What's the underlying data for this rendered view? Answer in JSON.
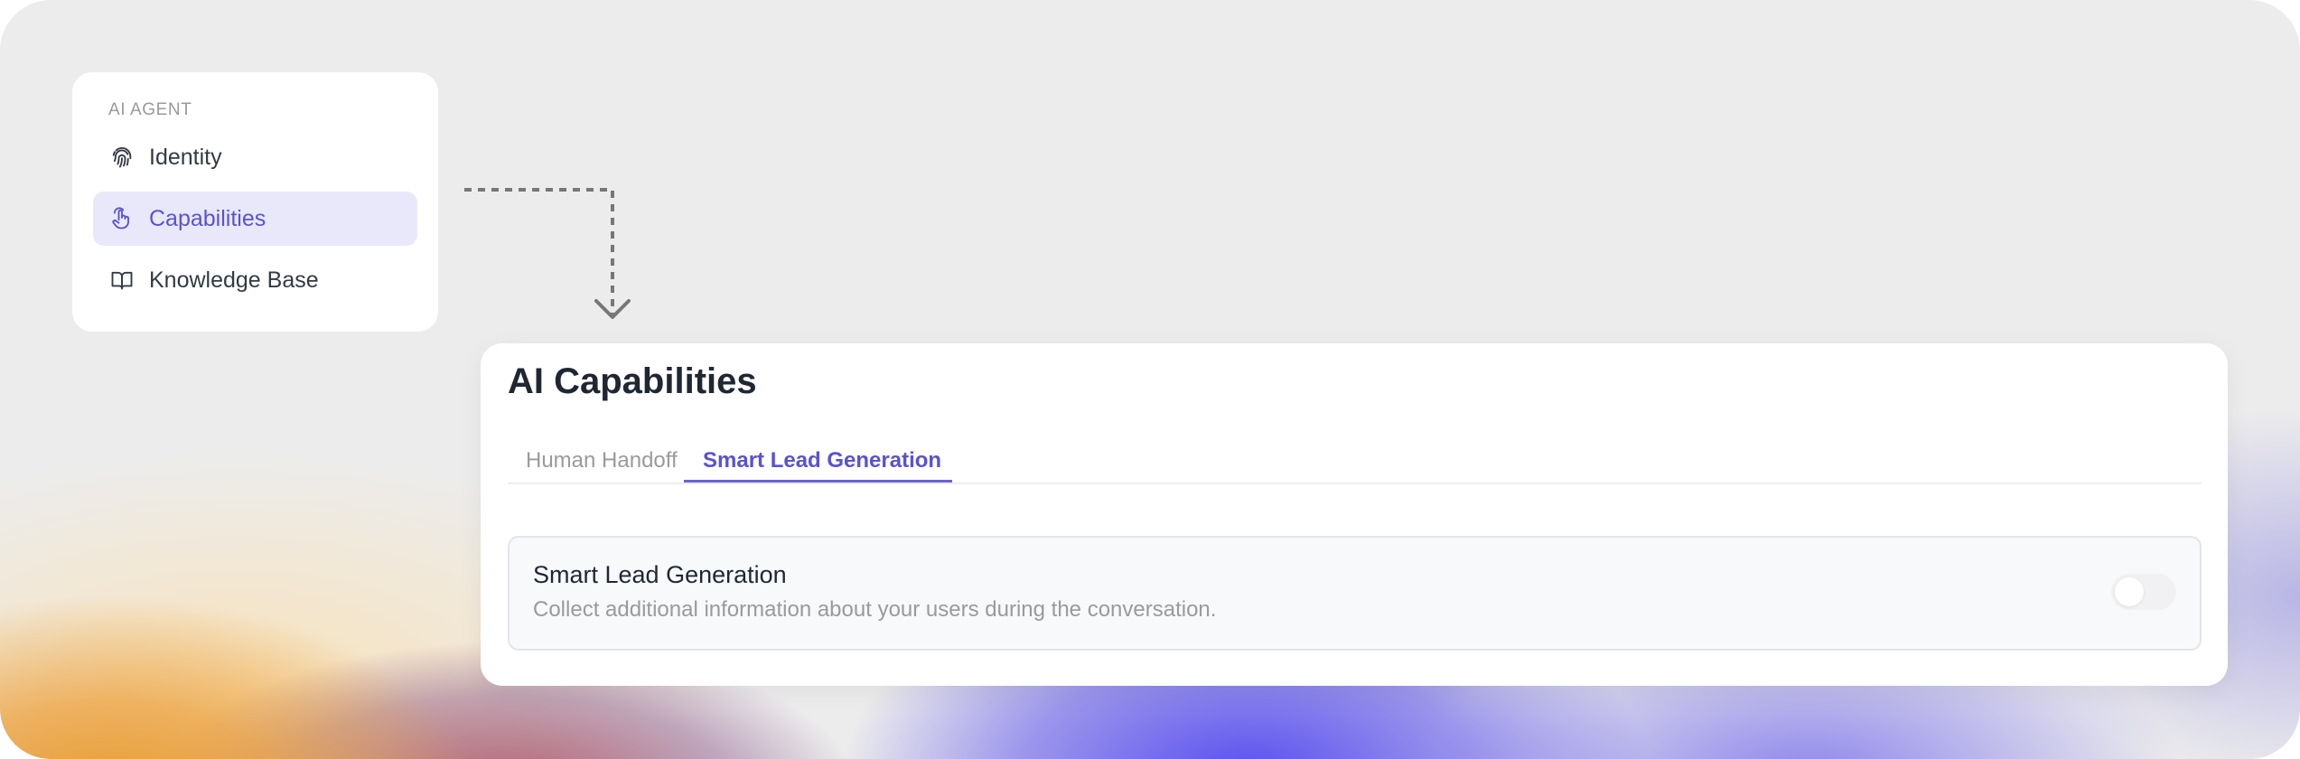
{
  "sidebar": {
    "section_label": "AI AGENT",
    "items": [
      {
        "label": "Identity",
        "icon": "fingerprint-icon",
        "active": false
      },
      {
        "label": "Capabilities",
        "icon": "pointer-hand-icon",
        "active": true
      },
      {
        "label": "Knowledge Base",
        "icon": "book-open-icon",
        "active": false
      }
    ]
  },
  "main": {
    "title": "AI Capabilities",
    "tabs": [
      {
        "label": "Human Handoff",
        "active": false
      },
      {
        "label": "Smart Lead Generation",
        "active": true
      }
    ],
    "setting": {
      "title": "Smart Lead Generation",
      "description": "Collect additional information about your users during the conversation.",
      "toggle_on": false
    }
  },
  "colors": {
    "accent": "#5a52d0",
    "active_bg": "#e9e8fb",
    "text_primary": "#1f2733",
    "text_muted": "#9a9a9a"
  }
}
